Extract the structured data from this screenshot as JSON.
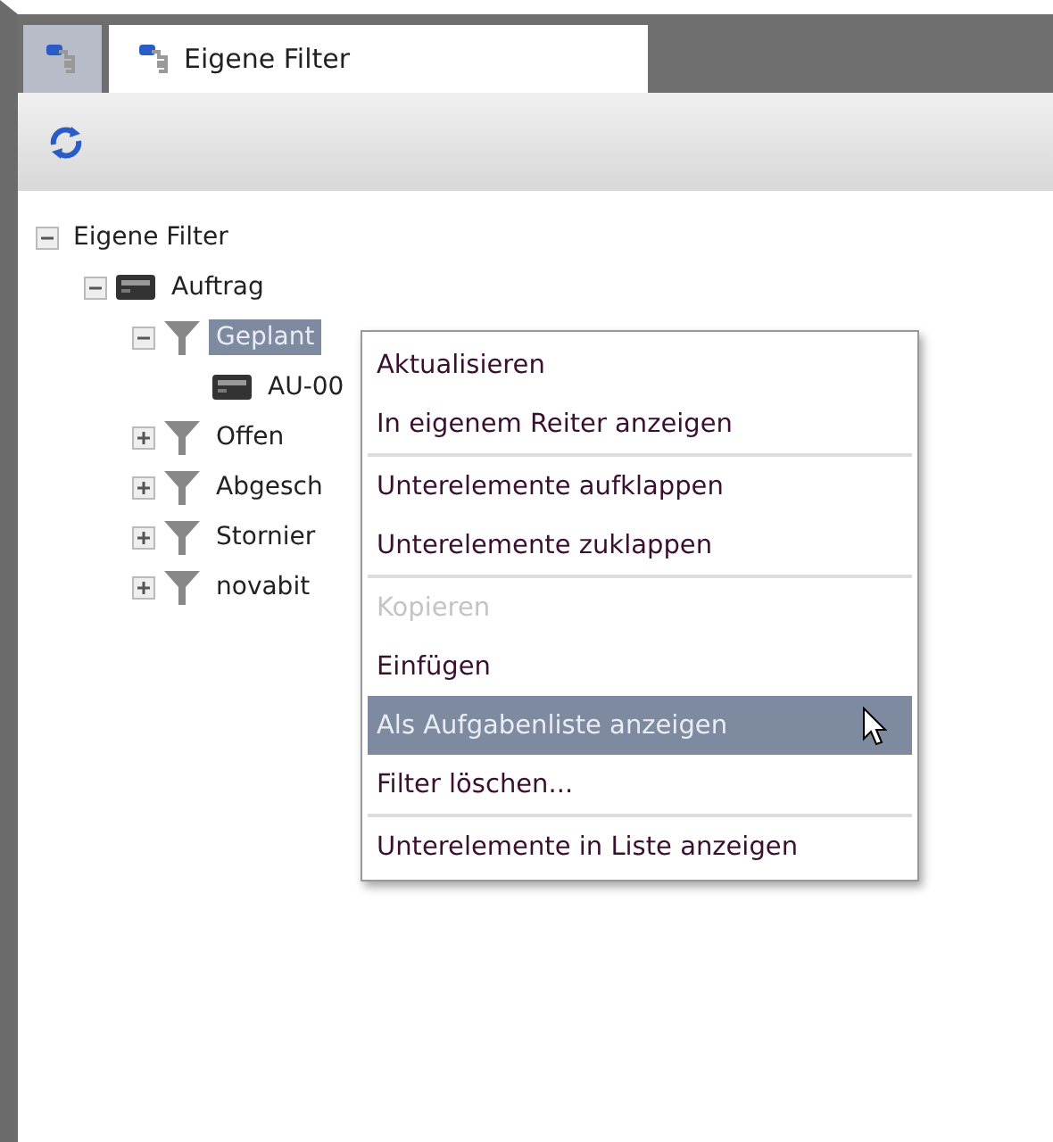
{
  "tabs": [
    {
      "kind": "icon",
      "selected": false
    },
    {
      "kind": "text",
      "label": "Eigene Filter",
      "selected": true
    }
  ],
  "tree": [
    {
      "label": "Eigene Filter",
      "expanded": true,
      "selected": false,
      "children": [
        {
          "label": "Auftrag",
          "kind": "record",
          "expanded": true,
          "selected": false,
          "children": [
            {
              "label": "Geplant",
              "kind": "filter",
              "expanded": true,
              "selected": true,
              "children": [
                {
                  "label": "AU-00",
                  "kind": "record",
                  "selected": false
                }
              ]
            },
            {
              "label": "Offen",
              "kind": "filter",
              "expanded": false,
              "selected": false
            },
            {
              "label": "Abgesch",
              "kind": "filter",
              "expanded": false,
              "selected": false
            },
            {
              "label": "Stornier",
              "kind": "filter",
              "expanded": false,
              "selected": false
            },
            {
              "label": "novabit",
              "kind": "filter",
              "expanded": false,
              "selected": false
            }
          ]
        }
      ]
    }
  ],
  "context_menu": {
    "groups": [
      [
        {
          "label": "Aktualisieren",
          "disabled": false,
          "selected": false
        },
        {
          "label": "In eigenem Reiter anzeigen",
          "disabled": false,
          "selected": false
        }
      ],
      [
        {
          "label": "Unterelemente aufklappen",
          "disabled": false,
          "selected": false
        },
        {
          "label": "Unterelemente zuklappen",
          "disabled": false,
          "selected": false
        }
      ],
      [
        {
          "label": "Kopieren",
          "disabled": true,
          "selected": false
        },
        {
          "label": "Einfügen",
          "disabled": false,
          "selected": false
        },
        {
          "label": "Als Aufgabenliste anzeigen",
          "disabled": false,
          "selected": true
        },
        {
          "label": "Filter löschen...",
          "disabled": false,
          "selected": false
        }
      ],
      [
        {
          "label": "Unterelemente in Liste anzeigen",
          "disabled": false,
          "selected": false
        }
      ]
    ]
  }
}
